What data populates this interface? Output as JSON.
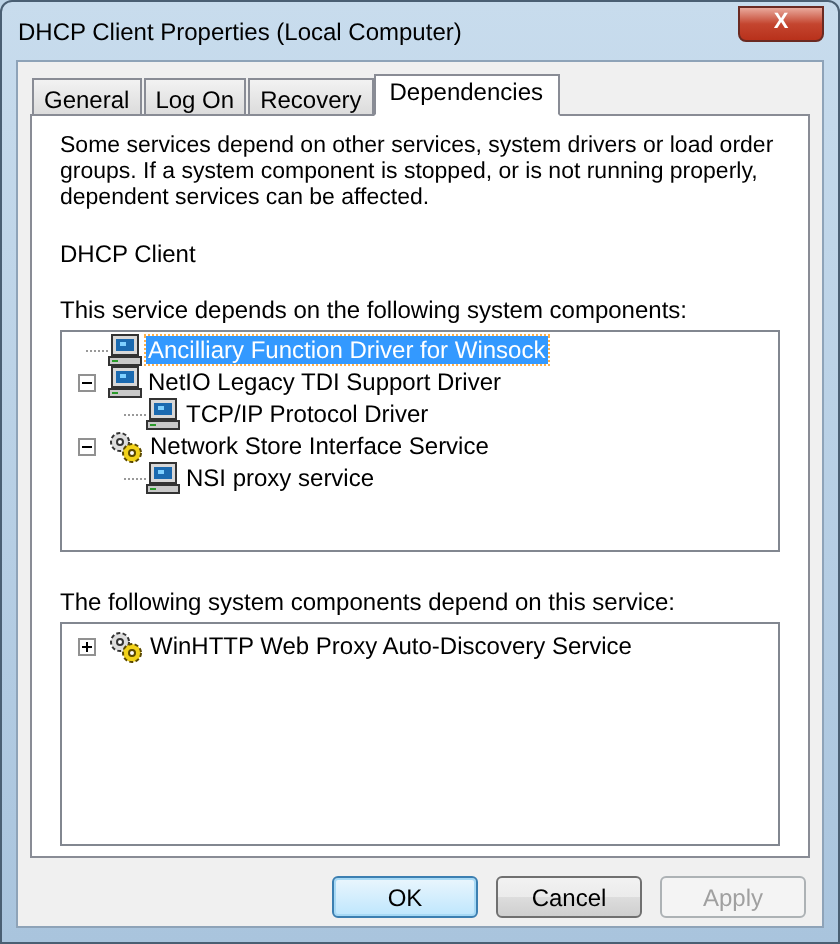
{
  "window": {
    "title": "DHCP Client Properties (Local Computer)",
    "close": "X"
  },
  "tabs": [
    {
      "label": "General",
      "selected": false
    },
    {
      "label": "Log On",
      "selected": false
    },
    {
      "label": "Recovery",
      "selected": false
    },
    {
      "label": "Dependencies",
      "selected": true
    }
  ],
  "intro": "Some services depend on other services, system drivers or load order groups. If a system component is stopped, or is not running properly, dependent services can be affected.",
  "service_name": "DHCP Client",
  "depends_on": {
    "label": "This service depends on the following system components:",
    "items": [
      {
        "label": "Ancilliary Function Driver for Winsock",
        "kind": "driver",
        "selected": true
      },
      {
        "label": "NetIO Legacy TDI Support Driver",
        "kind": "driver",
        "selected": false,
        "expanded": true,
        "children": [
          {
            "label": "TCP/IP Protocol Driver",
            "kind": "driver",
            "selected": false
          }
        ]
      },
      {
        "label": "Network Store Interface Service",
        "kind": "service",
        "selected": false,
        "expanded": true,
        "children": [
          {
            "label": "NSI proxy service",
            "kind": "driver",
            "selected": false
          }
        ]
      }
    ]
  },
  "dependents": {
    "label": "The following system components depend on this service:",
    "items": [
      {
        "label": "WinHTTP Web Proxy Auto-Discovery Service",
        "kind": "service",
        "selected": false,
        "expanded": false
      }
    ]
  },
  "buttons": [
    {
      "label": "OK",
      "disabled": false,
      "default": true
    },
    {
      "label": "Cancel",
      "disabled": false,
      "default": false
    },
    {
      "label": "Apply",
      "disabled": true,
      "default": false
    }
  ]
}
